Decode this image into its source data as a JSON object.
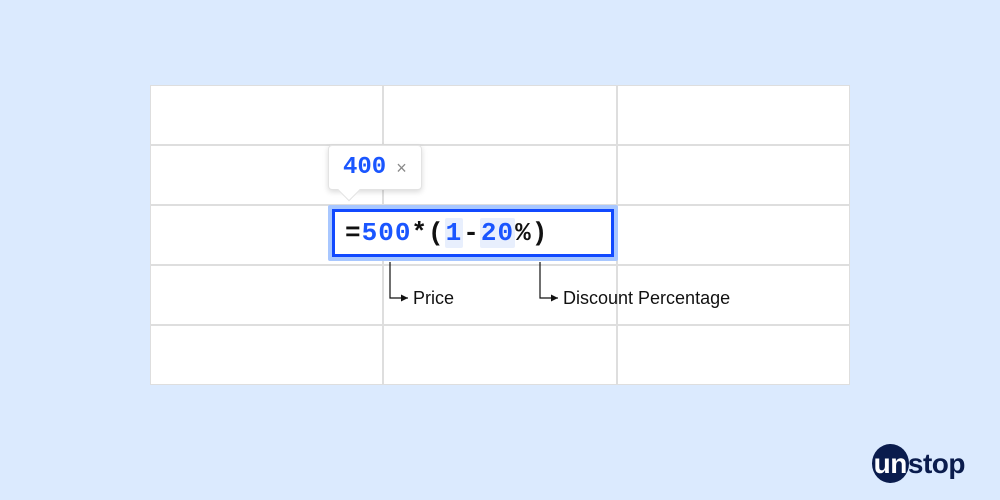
{
  "preview": {
    "value": "400",
    "close_glyph": "×"
  },
  "formula": {
    "eq": "=",
    "price_value": "500",
    "mult": "*",
    "paren_open": "(",
    "one": "1",
    "minus": "-",
    "discount_value": "20",
    "pct": "%",
    "paren_close": ")"
  },
  "callouts": {
    "price": "Price",
    "discount": "Discount Percentage"
  },
  "logo": {
    "part1": "un",
    "part2": "stop"
  }
}
